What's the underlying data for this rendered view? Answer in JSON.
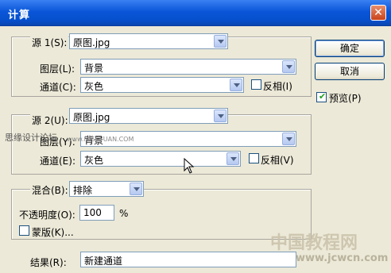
{
  "window": {
    "title": "计算",
    "close": "✕"
  },
  "source1": {
    "label": "源 1(S):",
    "file": "原图.jpg",
    "layer_label": "图层(L):",
    "layer": "背景",
    "channel_label": "通道(C):",
    "channel": "灰色",
    "invert_label": "反相(I)"
  },
  "source2": {
    "label": "源 2(U):",
    "file": "原图.jpg",
    "layer_label": "图层(Y):",
    "layer": "背景",
    "channel_label": "通道(E):",
    "channel": "灰色",
    "invert_label": "反相(V)"
  },
  "blend": {
    "label": "混合(B):",
    "mode": "排除",
    "opacity_label": "不透明度(O):",
    "opacity": "100",
    "unit": "%",
    "mask_label": "蒙版(K)..."
  },
  "result": {
    "label": "结果(R):",
    "value": "新建通道"
  },
  "buttons": {
    "ok": "确定",
    "cancel": "取消",
    "preview": "预览(P)"
  },
  "watermarks": {
    "left_text": "思缘设计论坛",
    "url_text": "www.MISSYUAN.COM",
    "logo_text": "中国教程网",
    "site_text": "www.jcwcn.com"
  }
}
